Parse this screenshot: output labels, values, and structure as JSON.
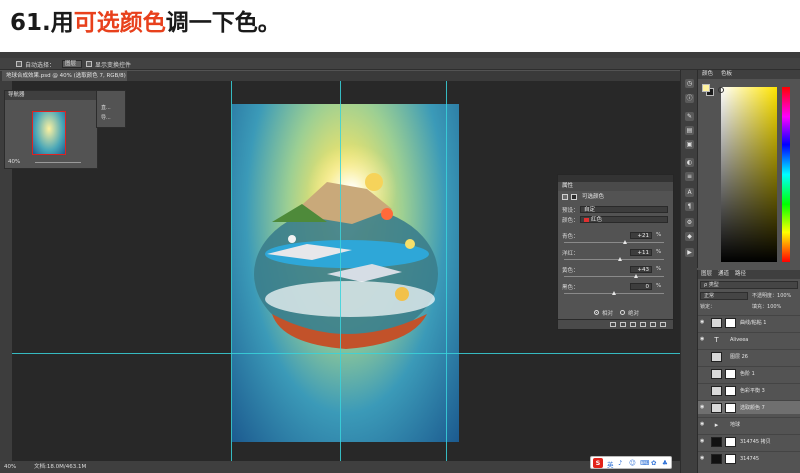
{
  "tutorial": {
    "step": "61.用",
    "highlight": "可选颜色",
    "rest": "调一下色。",
    "accent_color": "#e8401c"
  },
  "options_bar": {
    "auto_select_label": "自动选择：",
    "auto_select_value": "图层",
    "show_transform_label": "显示变换控件"
  },
  "document": {
    "tab_title": "地球合成效果.psd @ 40% (选取颜色 7, RGB/8) *"
  },
  "navigator": {
    "title": "导航器",
    "zoom": "40%",
    "ext_items": [
      "直...",
      "导..."
    ]
  },
  "properties": {
    "title": "属性",
    "panel_name": "可选颜色",
    "preset_label": "预设：",
    "preset_value": "自定",
    "colors_label": "颜色：",
    "colors_value": "红色",
    "sliders": [
      {
        "label": "青色：",
        "value": "+21",
        "pct": "%",
        "level": 0.61
      },
      {
        "label": "洋红：",
        "value": "+11",
        "pct": "%",
        "level": 0.56
      },
      {
        "label": "黄色：",
        "value": "+43",
        "pct": "%",
        "level": 0.72
      },
      {
        "label": "黑色：",
        "value": "0",
        "pct": "%",
        "level": 0.5
      }
    ],
    "radio_relative": "相对",
    "radio_absolute": "绝对",
    "radio_selected": "relative"
  },
  "color_panel": {
    "tabs": [
      "颜色",
      "色板"
    ],
    "foreground": "#fff3a0",
    "background": "#1b1b1b"
  },
  "layers_panel": {
    "tabs": [
      "图层",
      "通道",
      "路径"
    ],
    "filter_label": "ρ 类型",
    "blend_mode": "正常",
    "opacity_label": "不透明度：",
    "opacity_value": "100%",
    "lock_label": "锁定：",
    "fill_label": "填充：",
    "fill_value": "100%",
    "layers": [
      {
        "name": "曲线/粘粘 1",
        "mask": true,
        "eye": true,
        "dark": false,
        "selected": false
      },
      {
        "name": "Aliveea",
        "mask": false,
        "eye": true,
        "dark": false,
        "selected": false,
        "text": true
      },
      {
        "name": "图层 26",
        "mask": false,
        "eye": false,
        "dark": false,
        "selected": false
      },
      {
        "name": "色阶 1",
        "mask": true,
        "eye": false,
        "dark": false,
        "selected": false
      },
      {
        "name": "色彩平衡 3",
        "mask": true,
        "eye": false,
        "dark": false,
        "selected": false
      },
      {
        "name": "选取颜色 7",
        "mask": true,
        "eye": true,
        "dark": false,
        "selected": true
      },
      {
        "name": "地球",
        "mask": false,
        "eye": true,
        "dark": false,
        "selected": false,
        "group": true
      },
      {
        "name": "314745 拷贝",
        "mask": true,
        "eye": true,
        "dark": true,
        "selected": false
      },
      {
        "name": "314745",
        "mask": true,
        "eye": true,
        "dark": true,
        "selected": false
      }
    ]
  },
  "status": {
    "zoom": "40%",
    "doc": "文档:18.0M/463.1M"
  },
  "ime": {
    "logo": "S",
    "glyphs": [
      "英",
      "♪",
      "☺",
      "⌨",
      "✿",
      "♣"
    ]
  }
}
